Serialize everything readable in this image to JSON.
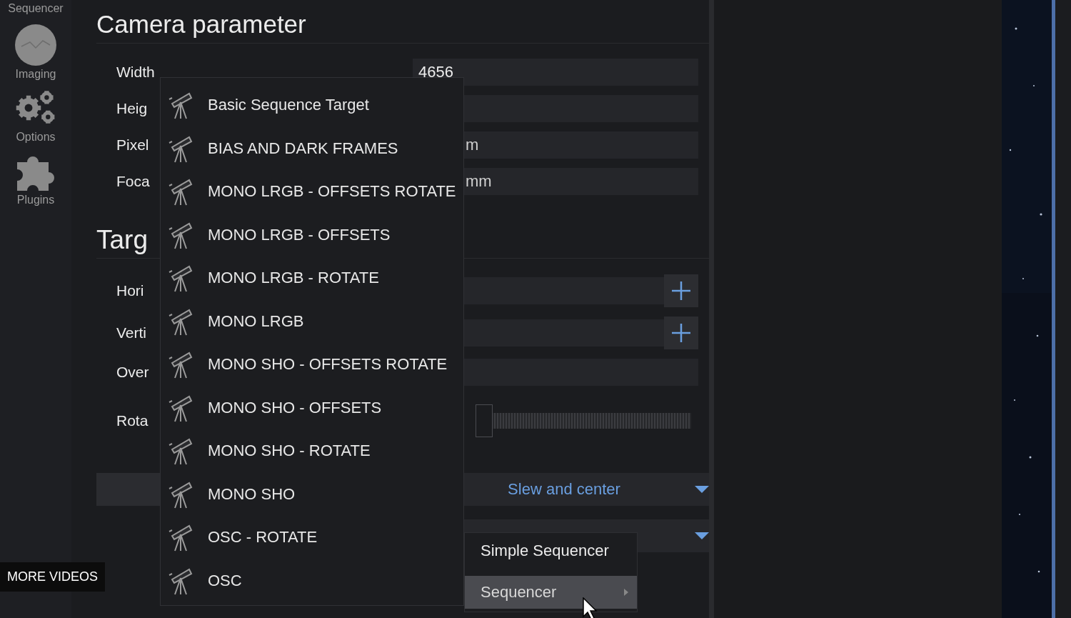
{
  "sidebar": {
    "items": [
      {
        "label": "Sequencer",
        "selected": false
      },
      {
        "label": "Imaging",
        "selected": false
      },
      {
        "label": "Options",
        "selected": false
      },
      {
        "label": "Plugins",
        "selected": false
      }
    ]
  },
  "camera": {
    "title": "Camera parameter",
    "fields": [
      {
        "label": "Width",
        "value": "4656"
      },
      {
        "label": "Heig"
      },
      {
        "label": "Pixel",
        "unit": "m"
      },
      {
        "label": "Foca",
        "unit": "mm"
      }
    ]
  },
  "targets": {
    "title": "Targ",
    "panels": [
      {
        "label": "Hori"
      },
      {
        "label": "Verti"
      }
    ],
    "overlap": {
      "label": "Over"
    },
    "rotation": {
      "label": "Rota",
      "level": 0
    },
    "slew": {
      "label": "Slew and center"
    }
  },
  "template_menu": {
    "items": [
      "Basic Sequence Target",
      "BIAS AND DARK FRAMES",
      "MONO LRGB - OFFSETS ROTATE",
      "MONO LRGB - OFFSETS",
      "MONO LRGB - ROTATE",
      "MONO LRGB",
      "MONO SHO - OFFSETS ROTATE",
      "MONO SHO - OFFSETS",
      "MONO SHO - ROTATE",
      "MONO SHO",
      "OSC - ROTATE",
      "OSC"
    ]
  },
  "submenu": {
    "items": [
      {
        "label": "Simple Sequencer",
        "selected": false,
        "has_submenu": false
      },
      {
        "label": "Sequencer",
        "selected": true,
        "has_submenu": true
      }
    ]
  },
  "video_overlay": {
    "label": "MORE VIDEOS"
  }
}
